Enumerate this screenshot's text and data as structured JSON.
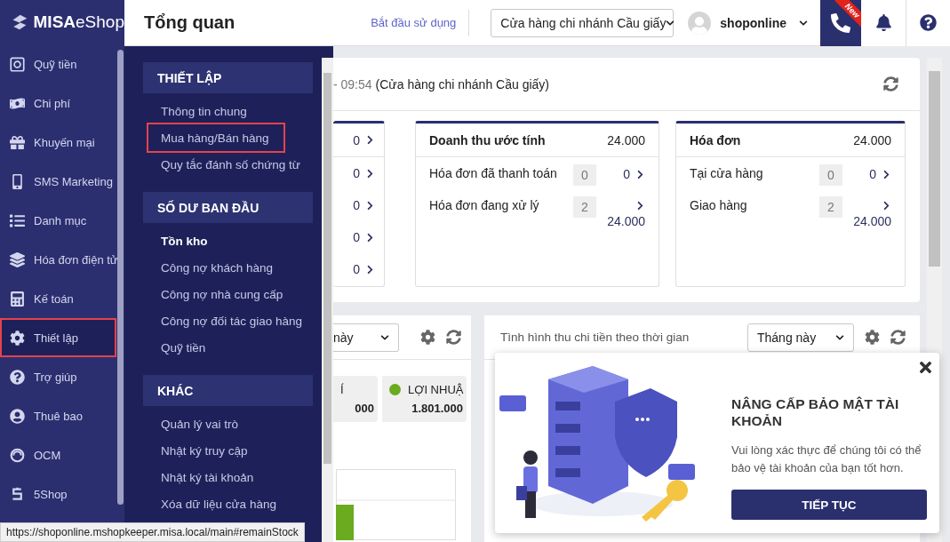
{
  "sidebar": {
    "logo": {
      "brand": "MISA",
      "product": "eShop"
    },
    "items": [
      {
        "label": "Quỹ tiền",
        "selected": false,
        "highlighted": false
      },
      {
        "label": "Chi phí",
        "selected": false,
        "highlighted": false
      },
      {
        "label": "Khuyến mại",
        "selected": false,
        "highlighted": false
      },
      {
        "label": "SMS Marketing",
        "selected": false,
        "highlighted": false
      },
      {
        "label": "Danh mục",
        "selected": false,
        "highlighted": false
      },
      {
        "label": "Hóa đơn điện tử",
        "selected": false,
        "highlighted": false
      },
      {
        "label": "Kế toán",
        "selected": false,
        "highlighted": false
      },
      {
        "label": "Thiết lập",
        "selected": true,
        "highlighted": true
      },
      {
        "label": "Trợ giúp",
        "selected": false,
        "highlighted": false
      },
      {
        "label": "Thuê bao",
        "selected": false,
        "highlighted": false
      },
      {
        "label": "OCM",
        "selected": false,
        "highlighted": false
      },
      {
        "label": "5Shop",
        "selected": false,
        "highlighted": false
      }
    ]
  },
  "header": {
    "title": "Tổng quan",
    "start_link": "Bắt đầu sử dụng",
    "store_select": "Cửa hàng chi nhánh Cầu giấy",
    "user": "shoponline",
    "call_badge": "New"
  },
  "settings_menu": {
    "sections": [
      {
        "title": "THIẾT LẬP",
        "items": [
          {
            "label": "Thông tin chung",
            "selected": false,
            "highlighted": false
          },
          {
            "label": "Mua hàng/Bán hàng",
            "selected": false,
            "highlighted": true
          },
          {
            "label": "Quy tắc đánh số chứng từ",
            "selected": false,
            "highlighted": false
          }
        ]
      },
      {
        "title": "SỐ DƯ BAN ĐẦU",
        "items": [
          {
            "label": "Tồn kho",
            "selected": true,
            "highlighted": false
          },
          {
            "label": "Công nợ khách hàng",
            "selected": false,
            "highlighted": false
          },
          {
            "label": "Công nợ nhà cung cấp",
            "selected": false,
            "highlighted": false
          },
          {
            "label": "Công nợ đối tác giao hàng",
            "selected": false,
            "highlighted": false
          },
          {
            "label": "Quỹ tiền",
            "selected": false,
            "highlighted": false
          }
        ]
      },
      {
        "title": "KHÁC",
        "items": [
          {
            "label": "Quản lý vai trò",
            "selected": false,
            "highlighted": false
          },
          {
            "label": "Nhật ký truy cập",
            "selected": false,
            "highlighted": false
          },
          {
            "label": "Nhật ký tài khoản",
            "selected": false,
            "highlighted": false
          },
          {
            "label": "Xóa dữ liệu cửa hàng",
            "selected": false,
            "highlighted": false
          }
        ]
      }
    ]
  },
  "overview": {
    "time": "- 09:54",
    "store": "(Cửa hàng chi nhánh Cầu giấy)",
    "partial_card": {
      "values": [
        "0",
        "0",
        "0",
        "0",
        "0"
      ]
    },
    "cards": [
      {
        "title": "Doanh thu ước tính",
        "total": "24.000",
        "rows": [
          {
            "label": "Hóa đơn đã thanh toán",
            "count": "0",
            "amount": "0"
          },
          {
            "label": "Hóa đơn đang xử lý",
            "count": "2",
            "amount": "24.000"
          }
        ]
      },
      {
        "title": "Hóa đơn",
        "total": "24.000",
        "rows": [
          {
            "label": "Tại cửa hàng",
            "count": "0",
            "amount": "0"
          },
          {
            "label": "Giao hàng",
            "count": "2",
            "amount": "24.000"
          }
        ]
      }
    ]
  },
  "profit_panel": {
    "period": "này",
    "chips": [
      {
        "label": "Í",
        "value": "000"
      },
      {
        "label": "LỢI NHUẬ",
        "value": "1.801.000",
        "color": "#6aab1f"
      }
    ]
  },
  "cashflow_panel": {
    "title": "Tình hình thu chi tiền theo thời gian",
    "period": "Tháng này"
  },
  "security_popup": {
    "title": "NÂNG CẤP BẢO MẬT TÀI KHOẢN",
    "message": "Vui lòng xác thực để chúng tôi có thể bảo vệ tài khoản của bạn tốt hơn.",
    "button": "TIẾP TỤC"
  },
  "status_url": "https://shoponline.mshopkeeper.misa.local/main#remainStock"
}
